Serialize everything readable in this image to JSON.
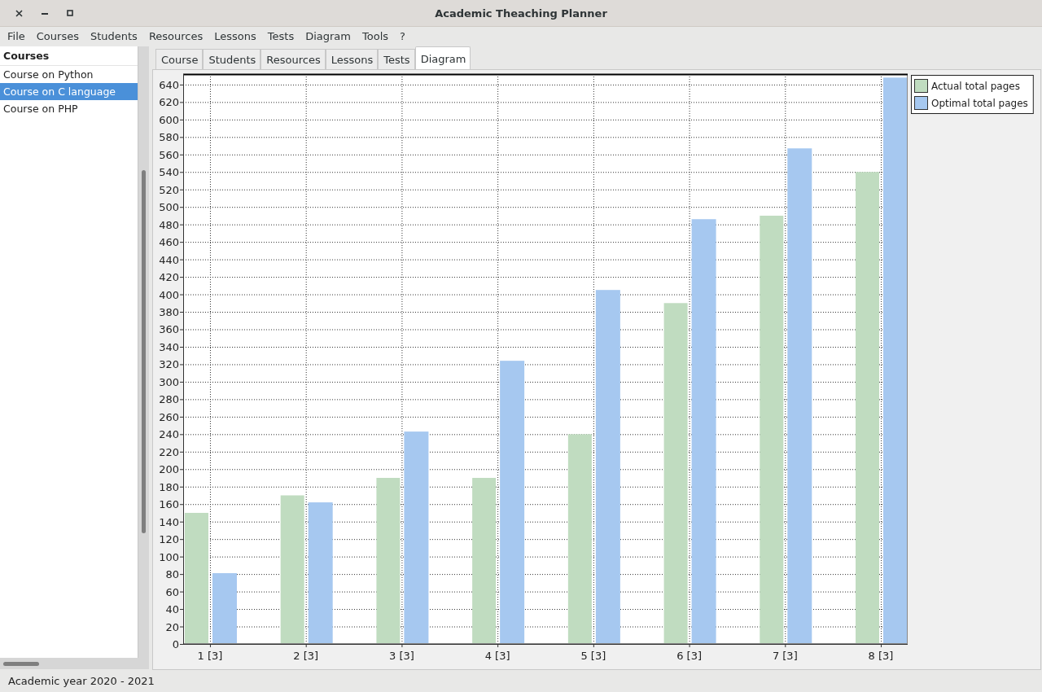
{
  "window": {
    "title": "Academic Theaching Planner"
  },
  "menu": [
    "File",
    "Courses",
    "Students",
    "Resources",
    "Lessons",
    "Tests",
    "Diagram",
    "Tools",
    "?"
  ],
  "sidebar": {
    "header": "Courses",
    "items": [
      {
        "label": "Course on Python",
        "selected": false
      },
      {
        "label": "Course on C language",
        "selected": true
      },
      {
        "label": "Course on PHP",
        "selected": false
      }
    ]
  },
  "tabs": [
    {
      "label": "Course",
      "selected": false
    },
    {
      "label": "Students",
      "selected": false
    },
    {
      "label": "Resources",
      "selected": false
    },
    {
      "label": "Lessons",
      "selected": false
    },
    {
      "label": "Tests",
      "selected": false
    },
    {
      "label": "Diagram",
      "selected": true
    }
  ],
  "diagram": {
    "chart_data": {
      "type": "bar",
      "categories": [
        "1 [3]",
        "2 [3]",
        "3 [3]",
        "4 [3]",
        "5 [3]",
        "6 [3]",
        "7 [3]",
        "8 [3]"
      ],
      "series": [
        {
          "name": "Actual total pages",
          "color": "#c0dcc0",
          "values": [
            150,
            170,
            190,
            190,
            240,
            390,
            490,
            540
          ]
        },
        {
          "name": "Optimal total pages",
          "color": "#a6c8f0",
          "values": [
            81,
            162,
            243,
            324,
            405,
            486,
            567,
            648
          ]
        }
      ],
      "ylim": [
        0,
        652
      ],
      "grid": true,
      "legend": true,
      "yticks": [
        0,
        20,
        40,
        60,
        80,
        100,
        120,
        140,
        160,
        180,
        200,
        220,
        240,
        260,
        280,
        300,
        320,
        340,
        360,
        380,
        400,
        420,
        440,
        460,
        480,
        500,
        520,
        540,
        560,
        580,
        600,
        620,
        640
      ]
    }
  },
  "status_bar": "Academic year 2020 - 2021"
}
